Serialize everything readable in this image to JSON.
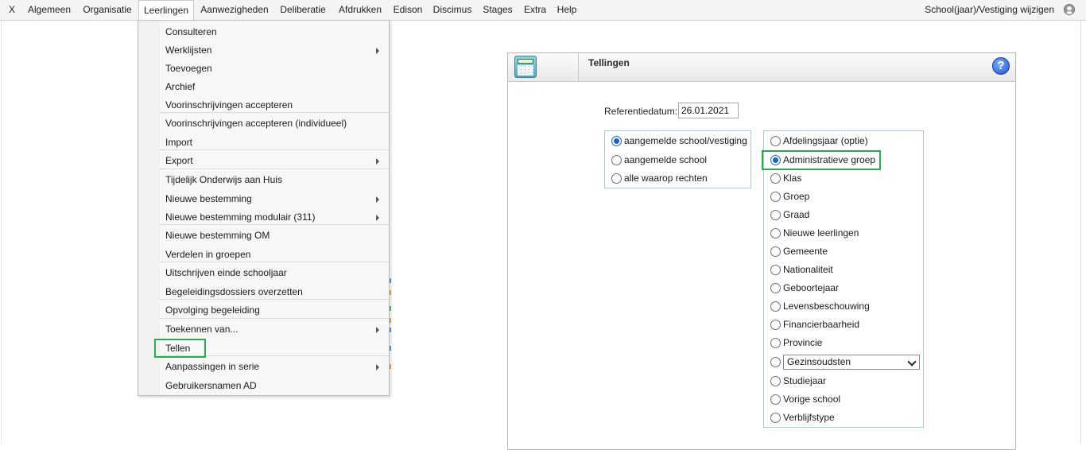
{
  "menubar": {
    "items": [
      "X",
      "Algemeen",
      "Organisatie",
      "Leerlingen",
      "Aanwezigheden",
      "Deliberatie",
      "Afdrukken",
      "Edison",
      "Discimus",
      "Stages",
      "Extra",
      "Help"
    ],
    "right_label": "School(jaar)/Vestiging wijzigen",
    "user_icon": "user-circle-icon"
  },
  "dropdown": {
    "items": [
      {
        "label": "Consulteren"
      },
      {
        "label": "Werklijsten",
        "submenu": true
      },
      {
        "label": "Toevoegen"
      },
      {
        "label": "Archief"
      },
      {
        "label": "Voorinschrijvingen accepteren"
      },
      {
        "label": "Voorinschrijvingen accepteren (individueel)"
      },
      {
        "label": "Import"
      },
      {
        "label": "Export",
        "submenu": true
      },
      {
        "label": "Tijdelijk Onderwijs aan Huis"
      },
      {
        "label": "Nieuwe bestemming",
        "submenu": true
      },
      {
        "label": "Nieuwe bestemming modulair (311)",
        "submenu": true
      },
      {
        "label": "Nieuwe bestemming OM"
      },
      {
        "label": "Verdelen in groepen"
      },
      {
        "label": "Uitschrijven einde schooljaar"
      },
      {
        "label": "Begeleidingsdossiers overzetten"
      },
      {
        "label": "Opvolging begeleiding"
      },
      {
        "label": "Toekennen van...",
        "submenu": true
      },
      {
        "label": "Tellen",
        "highlighted": true
      },
      {
        "label": "Aanpassingen in serie",
        "submenu": true
      },
      {
        "label": "Gebruikersnamen AD"
      }
    ]
  },
  "panel": {
    "title": "Tellingen",
    "icon": "calculator-icon",
    "help_icon": "help-icon",
    "help_glyph": "?",
    "referentiedatum_label": "Referentiedatum:",
    "referentiedatum_value": "26.01.2021",
    "scope_options": [
      {
        "label": "aangemelde school/vestiging",
        "selected": true
      },
      {
        "label": "aangemelde school",
        "selected": false
      },
      {
        "label": "alle waarop rechten",
        "selected": false
      }
    ],
    "group_options": [
      {
        "label": "Afdelingsjaar (optie)",
        "selected": false
      },
      {
        "label": "Administratieve groep",
        "selected": true
      },
      {
        "label": "Klas",
        "selected": false
      },
      {
        "label": "Groep",
        "selected": false
      },
      {
        "label": "Graad",
        "selected": false
      },
      {
        "label": "Nieuwe leerlingen",
        "selected": false
      },
      {
        "label": "Gemeente",
        "selected": false
      },
      {
        "label": "Nationaliteit",
        "selected": false
      },
      {
        "label": "Geboortejaar",
        "selected": false
      },
      {
        "label": "Levensbeschouwing",
        "selected": false
      },
      {
        "label": "Financierbaarheid",
        "selected": false
      },
      {
        "label": "Provincie",
        "selected": false
      },
      {
        "label": "",
        "selected": false,
        "select_value": "Gezinsoudsten"
      },
      {
        "label": "Studiejaar",
        "selected": false
      },
      {
        "label": "Vorige school",
        "selected": false
      },
      {
        "label": "Verblijfstype",
        "selected": false
      }
    ]
  },
  "colors": {
    "highlight_green": "#2fa84f",
    "radio_blue": "#1a64c8"
  }
}
